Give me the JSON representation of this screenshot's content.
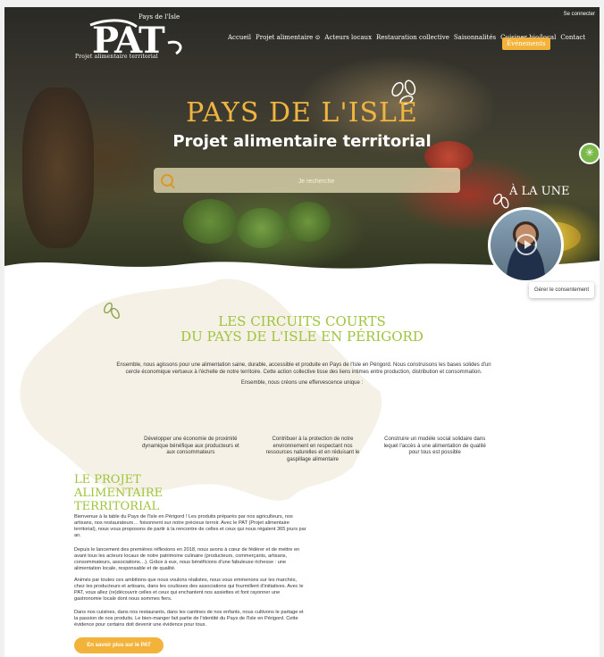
{
  "header": {
    "logo_text": "PAT",
    "logo_sup": "Pays de l'Isle",
    "logo_sub": "Projet alimentaire territorial",
    "login": "Se connecter",
    "nav": [
      "Accueil",
      "Projet alimentaire ⊙",
      "Acteurs locaux",
      "Restauration collective",
      "Saisonnalités",
      "Cuisiner bio/local",
      "Contact"
    ],
    "events": "Événements"
  },
  "hero": {
    "title": "PAYS DE L'ISLE",
    "subtitle": "Projet alimentaire territorial",
    "search_placeholder": "Je recherche",
    "une_label": "À LA UNE"
  },
  "consent": "Gérer le consentement",
  "circuits": {
    "title_line1": "LES CIRCUITS COURTS",
    "title_line2": "DU PAYS DE L'ISLE EN PÉRIGORD",
    "intro": "Ensemble, nous agissons pour une alimentation saine, durable, accessible et produite en Pays de l'Isle en Périgord. Nous construisons les bases solides d'un cercle économique vertueux à l'échelle de notre territoire. Cette action collective tisse des liens intimes entre production, distribution et consommation.",
    "intro2": "Ensemble, nous créons une effervescence unique :",
    "pillars": [
      "Développer une économie de proximité dynamique bénéfique aux producteurs et aux consommateurs",
      "Contribuer à la protection de notre environnement en respectant nos ressources naturelles et en réduisant le gaspillage alimentaire",
      "Construire un modèle social solidaire dans lequel l'accès à une alimentation de qualité pour tous est possible"
    ]
  },
  "pat": {
    "title_line1": "LE PROJET ALIMENTAIRE",
    "title_line2": "TERRITORIAL",
    "p1": "Bienvenue à la table du Pays de l'Isle en Périgord ! Les produits préparés par nos agriculteurs, nos artisans, nos restaurateurs… foisonnent sur notre précieux terroir. Avec le PAT (Projet alimentaire territorial), nous vous proposons de partir à la rencontre de celles et ceux qui nous régalent 365 jours par an.",
    "p2": "Depuis le lancement des premières réflexions en 2018, nous avons à cœur de fédérer et de mettre en avant tous les acteurs locaux de notre patrimoine culinaire (producteurs, commerçants, artisans, consommateurs, associations…). Grâce à eux, nous bénéficions d'une fabuleuse richesse : une alimentation locale, responsable et de qualité.",
    "p3": "Animés par toutes ces ambitions que nous voulons réalistes, nous vous emmenons sur les marchés, chez les producteurs et artisans, dans les coulisses des associations qui fourmillent d'initiatives. Avec le PAT, vous allez (re)découvrir celles et ceux qui enchantent nos assiettes et font rayonner une gastronomie locale dont nous sommes fiers.",
    "p4": "Dans nos cuisines, dans nos restaurants, dans les cantines de nos enfants, nous cultivons le partage et la passion de nos produits. Le bien-manger fait partie de l'identité du Pays de l'Isle en Périgord. Cette évidence pour certains doit devenir une évidence pour tous.",
    "cta": "En savoir plus sur le PAT"
  },
  "colors": {
    "accent_green": "#9fc43c",
    "accent_orange": "#f3b23a"
  }
}
